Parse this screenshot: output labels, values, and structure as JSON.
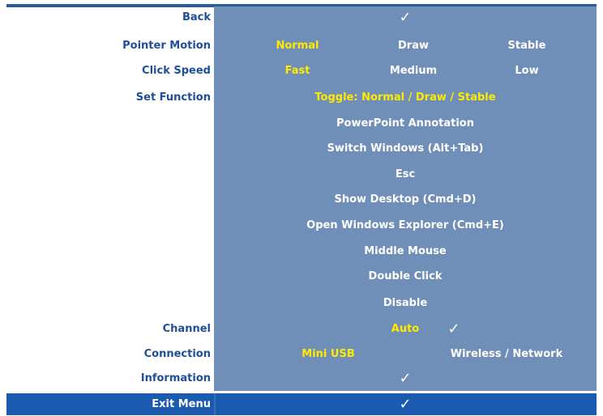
{
  "colors": {
    "panel": "#6f8fb8",
    "label": "#1f4f9a",
    "selected": "#ffea00",
    "exit_bar": "#1a5bb1"
  },
  "menu": {
    "back": {
      "label": "Back",
      "check": "✓"
    },
    "pointer_motion": {
      "label": "Pointer Motion",
      "options": [
        "Normal",
        "Draw",
        "Stable"
      ],
      "selected": "Normal"
    },
    "click_speed": {
      "label": "Click Speed",
      "options": [
        "Fast",
        "Medium",
        "Low"
      ],
      "selected": "Fast"
    },
    "set_function": {
      "label": "Set Function",
      "options": [
        "Toggle: Normal / Draw / Stable",
        "PowerPoint Annotation",
        "Switch Windows (Alt+Tab)",
        "Esc",
        "Show Desktop (Cmd+D)",
        "Open Windows Explorer (Cmd+E)",
        "Middle Mouse",
        "Double Click",
        "Disable"
      ],
      "selected": "Toggle: Normal / Draw / Stable"
    },
    "channel": {
      "label": "Channel",
      "value": "Auto",
      "check": "✓"
    },
    "connection": {
      "label": "Connection",
      "options": [
        "Mini USB",
        "Wireless / Network"
      ],
      "selected": "Mini USB"
    },
    "information": {
      "label": "Information",
      "check": "✓"
    },
    "exit": {
      "label": "Exit Menu",
      "check": "✓"
    }
  }
}
